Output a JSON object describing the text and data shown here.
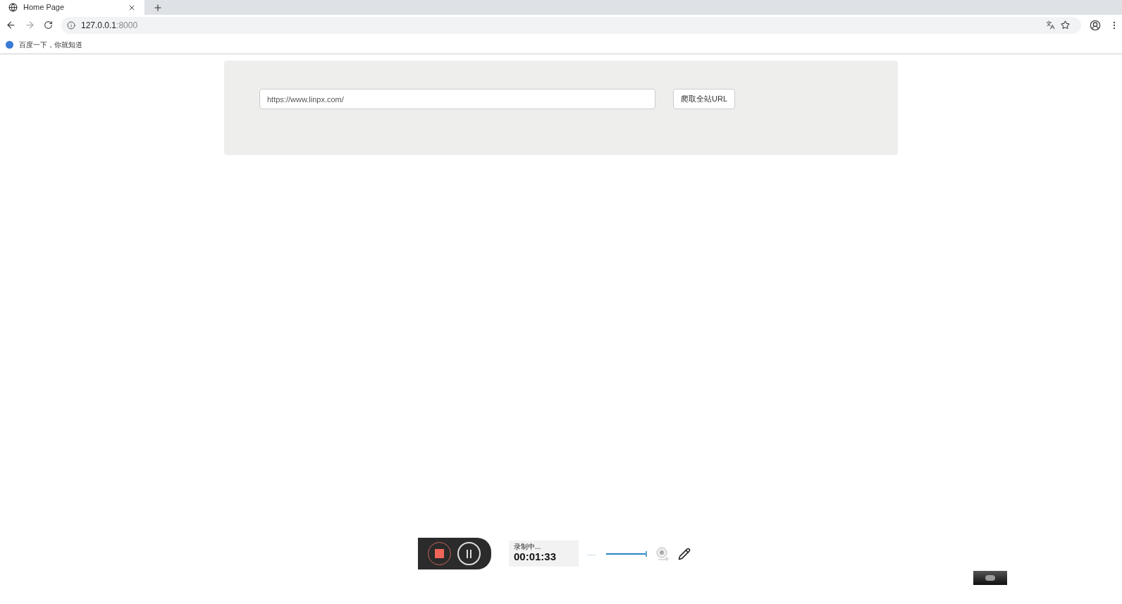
{
  "browser": {
    "tab": {
      "title": "Home Page",
      "selected": true
    },
    "address": {
      "host": "127.0.0.1",
      "port": ":8000"
    },
    "bookmarks": [
      "百度一下，你就知道"
    ]
  },
  "form": {
    "url_value": "https://www.linpx.com/",
    "button": "爬取全站URL"
  },
  "recorder": {
    "status": "录制中...",
    "time": "00:01:33",
    "dots": "....."
  }
}
